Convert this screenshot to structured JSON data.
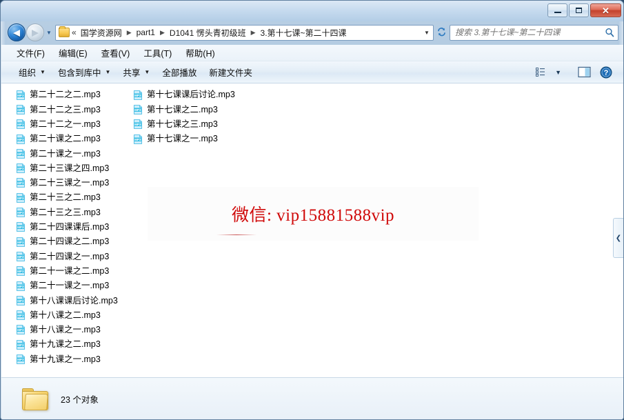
{
  "window": {
    "controls": {
      "minimize_label": "—",
      "maximize_label": "",
      "close_label": "✕"
    }
  },
  "navigation": {
    "back_arrow": "◀",
    "forward_arrow": "▶",
    "history_caret": "▼",
    "refresh_icon": "↻"
  },
  "address": {
    "folder_icon": "folder-icon",
    "overflow": "«",
    "separator": "▶",
    "crumbs": [
      "国学资源网",
      "part1",
      "D1041 愣头青初级班",
      "3.第十七课~第二十四课"
    ],
    "dropdown_caret": "▼"
  },
  "search": {
    "placeholder": "搜索 3.第十七课~第二十四课",
    "value": ""
  },
  "menu": {
    "items": [
      {
        "label": "文件(F)"
      },
      {
        "label": "编辑(E)"
      },
      {
        "label": "查看(V)"
      },
      {
        "label": "工具(T)"
      },
      {
        "label": "帮助(H)"
      }
    ]
  },
  "toolbar": {
    "items": [
      {
        "label": "组织",
        "caret": "▼"
      },
      {
        "label": "包含到库中",
        "caret": "▼"
      },
      {
        "label": "共享",
        "caret": "▼"
      },
      {
        "label": "全部播放",
        "caret": ""
      },
      {
        "label": "新建文件夹",
        "caret": ""
      }
    ],
    "view_caret": "▼",
    "view_icon": "view-mode-icon",
    "preview_icon": "preview-pane-icon",
    "help_icon": "help-icon"
  },
  "files": {
    "icon_label": "MP3",
    "items": [
      "第二十二之二.mp3",
      "第二十二之三.mp3",
      "第二十二之一.mp3",
      "第二十课之二.mp3",
      "第二十课之一.mp3",
      "第二十三课之四.mp3",
      "第二十三课之一.mp3",
      "第二十三之二.mp3",
      "第二十三之三.mp3",
      "第二十四课课后.mp3",
      "第二十四课之二.mp3",
      "第二十四课之一.mp3",
      "第二十一课之二.mp3",
      "第二十一课之一.mp3",
      "第十八课课后讨论.mp3",
      "第十八课之二.mp3",
      "第十八课之一.mp3",
      "第十九课之二.mp3",
      "第十九课之一.mp3",
      "第十七课课后讨论.mp3",
      "第十七课之二.mp3",
      "第十七课之三.mp3",
      "第十七课之一.mp3"
    ]
  },
  "watermark": {
    "text": "微信: vip15881588vip",
    "color": "#d00a0a"
  },
  "splitter": {
    "chevron": "❮"
  },
  "status": {
    "count_text": "23 个对象",
    "folder_icon": "folder-icon"
  }
}
